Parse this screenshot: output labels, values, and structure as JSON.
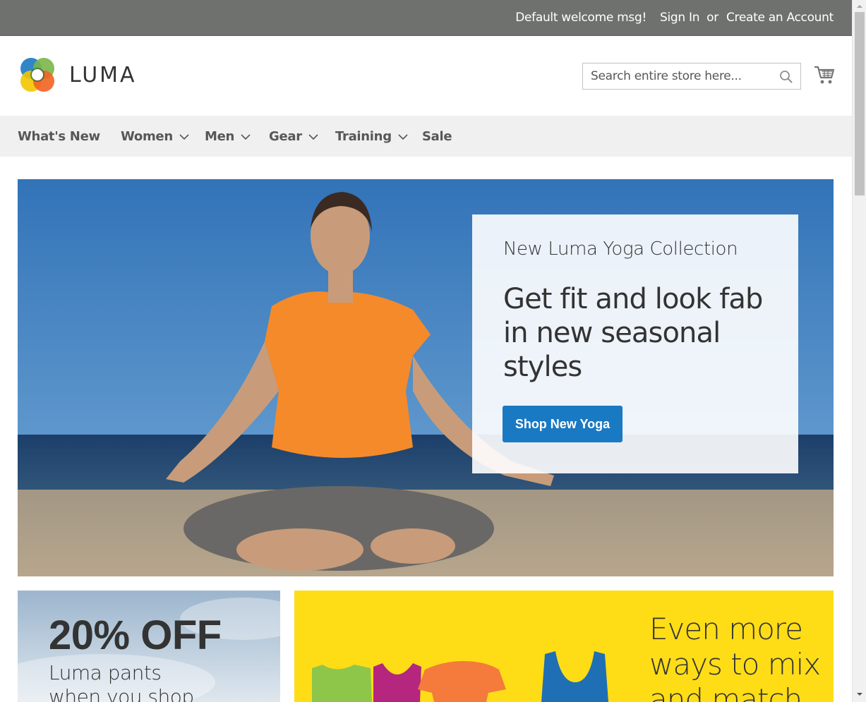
{
  "top_bar": {
    "welcome": "Default welcome msg!",
    "sign_in": "Sign In",
    "or": "or",
    "create_account": "Create an Account"
  },
  "header": {
    "logo_text": "LUMA",
    "search_placeholder": "Search entire store here...",
    "search_icon": "search-icon",
    "cart_icon": "cart-icon"
  },
  "nav": {
    "items": [
      {
        "label": "What's New",
        "has_dropdown": false
      },
      {
        "label": "Women",
        "has_dropdown": true
      },
      {
        "label": "Men",
        "has_dropdown": true
      },
      {
        "label": "Gear",
        "has_dropdown": true
      },
      {
        "label": "Training",
        "has_dropdown": true
      },
      {
        "label": "Sale",
        "has_dropdown": false
      }
    ]
  },
  "hero": {
    "kicker": "New Luma Yoga Collection",
    "headline": "Get fit and look fab in new seasonal styles",
    "button": "Shop New Yoga"
  },
  "promo_left": {
    "title": "20% OFF",
    "subtitle_line1": "Luma pants",
    "subtitle_line2": "when you shop"
  },
  "promo_right": {
    "text_line1": "Even more",
    "text_line2": "ways to mix",
    "text_line3": "and match"
  },
  "colors": {
    "top_bar": "#6e716e",
    "nav_bg": "#f0f0f0",
    "primary_button": "#1979c3",
    "promo_yellow": "#fedd17"
  }
}
